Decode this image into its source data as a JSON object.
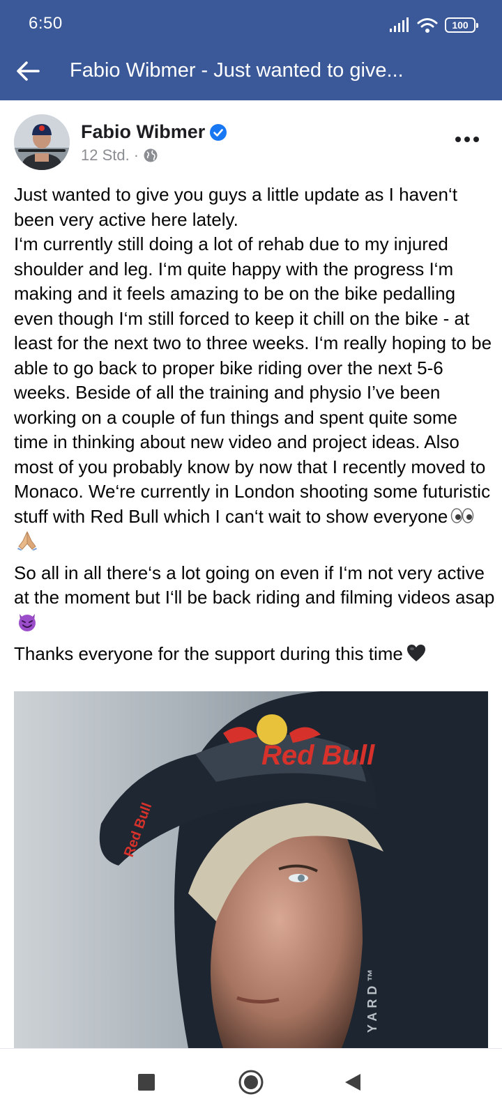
{
  "status_bar": {
    "time": "6:50",
    "battery": "100",
    "icons": [
      "signal-icon",
      "wifi-icon",
      "battery-icon"
    ]
  },
  "app_bar": {
    "title": "Fabio Wibmer - Just wanted to give...",
    "back_icon": "arrow-left-icon"
  },
  "post": {
    "author": "Fabio Wibmer",
    "verified": true,
    "time": "12 Std.",
    "separator": "·",
    "audience_icon": "globe-icon",
    "more_icon": "more-horizontal-icon",
    "paragraphs": [
      {
        "text": "Just wanted to give you guys a little update as I haven‘t been very active here lately.\nI‘m currently still doing a lot of rehab due to my injured shoulder and leg. I‘m quite happy with the progress I‘m making and it feels amazing to be on the bike pedalling even though I‘m still forced to keep it chill on the bike - at least for the next two to three weeks. I‘m really hoping to be able to go back to proper bike riding over the next 5-6 weeks. Beside of all the training and physio I’ve been working on a couple of fun things and spent quite some time in thinking about new video and project ideas. Also most of you probably know by now that I recently moved to Monaco. We‘re currently in London shooting some futuristic stuff with Red Bull which I can‘t wait to show everyone",
        "emoji": [
          "eyes-emoji",
          "folded-hands-emoji"
        ]
      },
      {
        "text": "So all in all there‘s a lot going on even if I‘m not very active at the moment but I‘ll be back riding and filming videos asap",
        "emoji": [
          "smiling-devil-emoji"
        ]
      },
      {
        "text": "Thanks everyone for the support during this time",
        "emoji": [
          "black-heart-emoji"
        ]
      }
    ],
    "photo": {
      "subject": "portrait of rider in hooded cap",
      "cap_text": "Red Bull",
      "cap_side_text": "Red Bull",
      "hood_text": "YARD™"
    }
  },
  "nav_bar": {
    "items": [
      "recent-apps-button",
      "home-button",
      "back-button"
    ]
  },
  "colors": {
    "header_bg": "#3b5998",
    "verified_blue": "#1877f2",
    "meta_gray": "#8a8d91",
    "text": "#050505"
  }
}
